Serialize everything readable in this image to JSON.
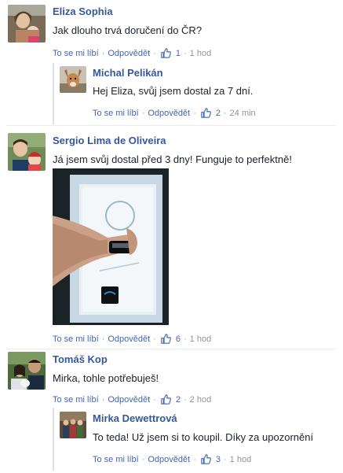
{
  "actions": {
    "like": "To se mi líbí",
    "reply": "Odpovědět"
  },
  "comments": [
    {
      "author": "Eliza Sophia",
      "text": "Jak dlouho trvá doručení do ČR?",
      "likes": "1",
      "time": "1 hod"
    },
    {
      "author": "Michal Pelikán",
      "text": "Hej Eliza, svůj jsem dostal za 7 dní.",
      "likes": "2",
      "time": "24 min"
    },
    {
      "author": "Sergio Lima de Oliveira",
      "text": "Já jsem svůj dostal před 3 dny! Funguje to perfektně!",
      "likes": "6",
      "time": "1 hod"
    },
    {
      "author": "Tomáš Kop",
      "text": "Mirka, tohle potřebuješ!",
      "likes": "2",
      "time": "2 hod"
    },
    {
      "author": "Mirka Dewettrová",
      "text": "To teda! Už jsem si to koupil. Díky za upozornění",
      "likes": "3",
      "time": "1 hod"
    }
  ],
  "colors": {
    "link": "#365899",
    "action": "#4267b2",
    "meta": "#90949c",
    "text": "#1d2129"
  },
  "icons": {
    "like": "thumbs-up-icon"
  }
}
